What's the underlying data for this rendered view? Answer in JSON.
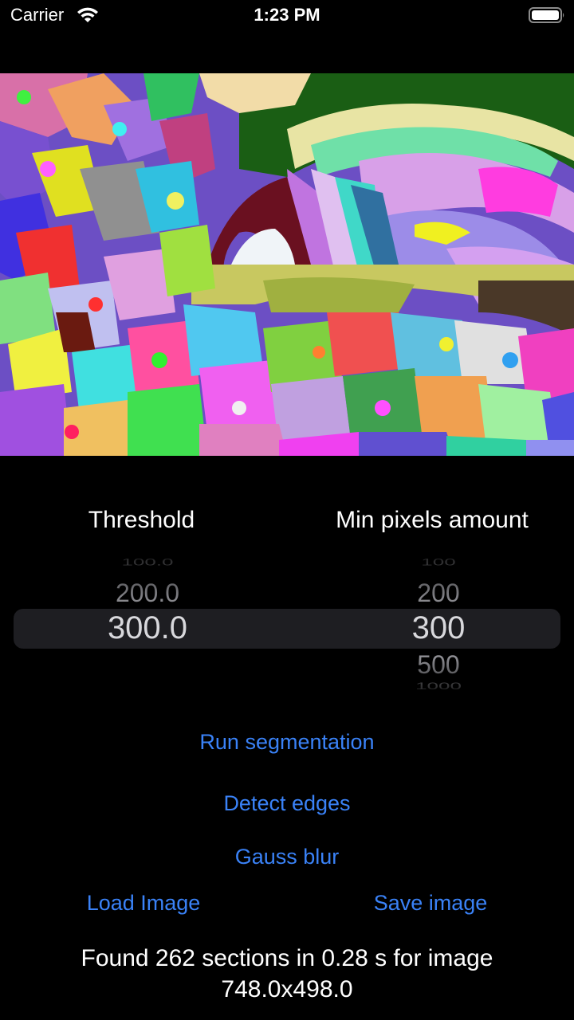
{
  "status_bar": {
    "carrier": "Carrier",
    "time": "1:23 PM",
    "wifi_icon": "wifi-icon",
    "battery_icon": "battery-full-icon"
  },
  "image": {
    "description_icon": "segmented-image"
  },
  "pickers": {
    "threshold": {
      "label": "Threshold",
      "items": [
        "100.0",
        "200.0",
        "300.0",
        "",
        ""
      ],
      "selected": "300.0"
    },
    "min_pixels": {
      "label": "Min pixels amount",
      "items": [
        "100",
        "200",
        "300",
        "500",
        "1000"
      ],
      "selected": "300"
    }
  },
  "buttons": {
    "run_segmentation": "Run segmentation",
    "detect_edges": "Detect edges",
    "gauss_blur": "Gauss blur",
    "load_image": "Load Image",
    "save_image": "Save image"
  },
  "result": {
    "line1": "Found 262 sections in 0.28 s for image",
    "line2": "748.0x498.0"
  },
  "colors": {
    "accent": "#3a82f7",
    "background": "#000000",
    "picker_highlight": "#1e1e22"
  }
}
